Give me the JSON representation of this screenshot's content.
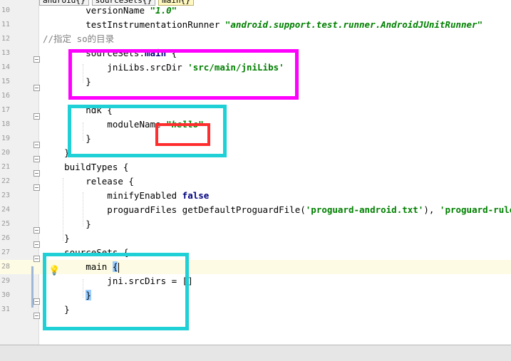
{
  "breadcrumb": [
    "android{}",
    "sourceSets{}",
    "main{}"
  ],
  "lines": [
    {
      "n": "10",
      "parts": [
        {
          "t": "        versionName "
        },
        {
          "t": "\"1.0\"",
          "c": "str it"
        }
      ]
    },
    {
      "n": "11",
      "parts": [
        {
          "t": "        testInstrumentationRunner "
        },
        {
          "t": "\"android.support.test.runner.AndroidJUnitRunner\"",
          "c": "str it"
        }
      ]
    },
    {
      "n": "12",
      "parts": [
        {
          "t": "//指定 so的目录",
          "c": "cm"
        }
      ]
    },
    {
      "n": "13",
      "parts": [
        {
          "t": "        sourceSets."
        },
        {
          "t": "main",
          "c": "bold"
        },
        {
          "t": " {"
        }
      ]
    },
    {
      "n": "14",
      "parts": [
        {
          "t": "            jniLibs.srcDir "
        },
        {
          "t": "'src/main/jniLibs'",
          "c": "str"
        }
      ]
    },
    {
      "n": "15",
      "parts": [
        {
          "t": "        }"
        }
      ]
    },
    {
      "n": "16",
      "parts": []
    },
    {
      "n": "17",
      "parts": [
        {
          "t": "        ndk {"
        }
      ]
    },
    {
      "n": "18",
      "parts": [
        {
          "t": "            moduleName "
        },
        {
          "t": "\"hello\"",
          "c": "str it"
        }
      ]
    },
    {
      "n": "19",
      "parts": [
        {
          "t": "        }"
        }
      ]
    },
    {
      "n": "20",
      "parts": [
        {
          "t": "    }"
        }
      ]
    },
    {
      "n": "21",
      "parts": [
        {
          "t": "    buildTypes {"
        }
      ]
    },
    {
      "n": "22",
      "parts": [
        {
          "t": "        release {"
        }
      ]
    },
    {
      "n": "23",
      "parts": [
        {
          "t": "            minifyEnabled "
        },
        {
          "t": "false",
          "c": "kw"
        }
      ]
    },
    {
      "n": "24",
      "parts": [
        {
          "t": "            proguardFiles getDefaultProguardFile("
        },
        {
          "t": "'proguard-android.txt'",
          "c": "str"
        },
        {
          "t": "), "
        },
        {
          "t": "'proguard-rules",
          "c": "str"
        }
      ]
    },
    {
      "n": "25",
      "parts": [
        {
          "t": "        }"
        }
      ]
    },
    {
      "n": "26",
      "parts": [
        {
          "t": "    }"
        }
      ]
    },
    {
      "n": "27",
      "parts": [
        {
          "t": "    sourceSets {"
        }
      ]
    },
    {
      "n": "28",
      "current": true,
      "parts": [
        {
          "t": "        main "
        },
        {
          "t": "{",
          "c": "brace-hl"
        },
        {
          "caret": true
        }
      ]
    },
    {
      "n": "29",
      "parts": [
        {
          "t": "            jni.srcDirs = []"
        }
      ]
    },
    {
      "n": "30",
      "parts": [
        {
          "t": "        "
        },
        {
          "t": "}",
          "c": "brace-hl"
        }
      ]
    },
    {
      "n": "31",
      "parts": [
        {
          "t": "    }"
        }
      ]
    }
  ],
  "icons": {
    "intention": "lightbulb-icon"
  },
  "colors": {
    "annotation_magenta": "#ff00ff",
    "annotation_cyan": "#1fd1d6",
    "annotation_red": "#ff2d2d",
    "current_line": "#fdfbe3"
  }
}
